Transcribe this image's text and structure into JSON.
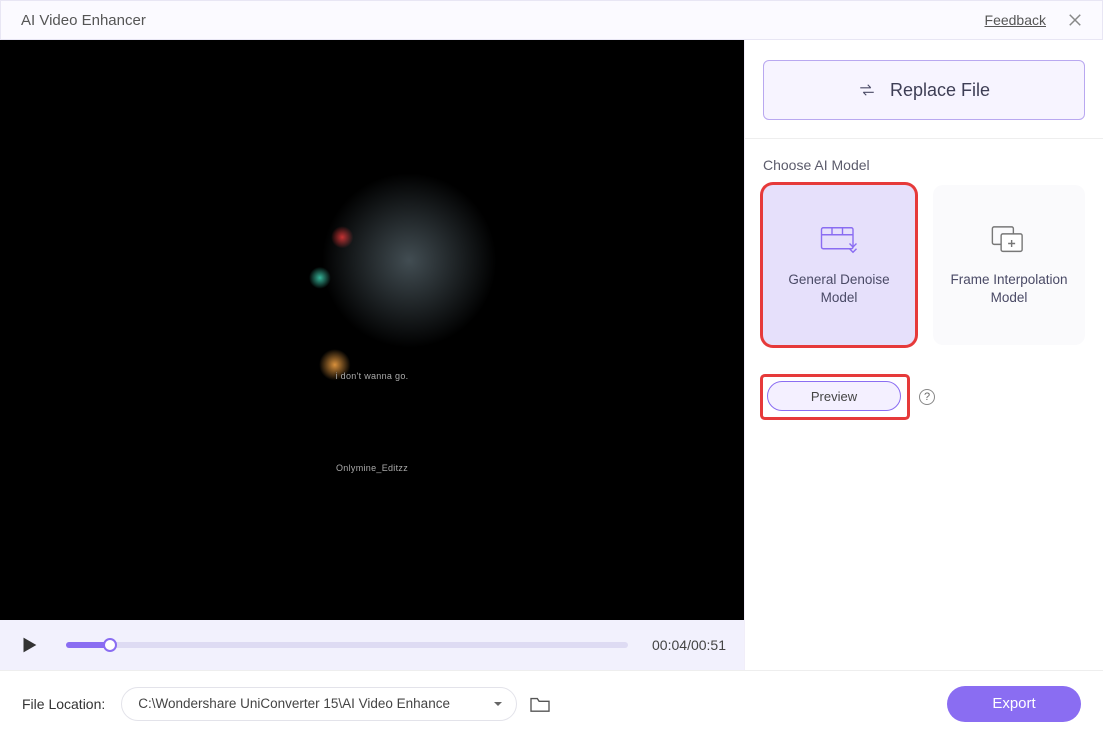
{
  "header": {
    "title": "AI Video Enhancer",
    "feedback_label": "Feedback"
  },
  "video": {
    "caption1": "i don't wanna go.",
    "caption2": "Onlymine_Editzz"
  },
  "player": {
    "current_time": "00:04",
    "total_time": "00:51",
    "progress_fraction": 0.078
  },
  "side": {
    "replace_label": "Replace File",
    "section_label": "Choose AI Model",
    "models": [
      {
        "label": "General Denoise Model",
        "selected": true
      },
      {
        "label": "Frame Interpolation Model",
        "selected": false
      }
    ],
    "preview_label": "Preview"
  },
  "bottom": {
    "file_location_label": "File Location:",
    "path_value": "C:\\Wondershare UniConverter 15\\AI Video Enhance",
    "export_label": "Export"
  },
  "colors": {
    "accent": "#8a6df2",
    "highlight": "#e63a3a"
  }
}
